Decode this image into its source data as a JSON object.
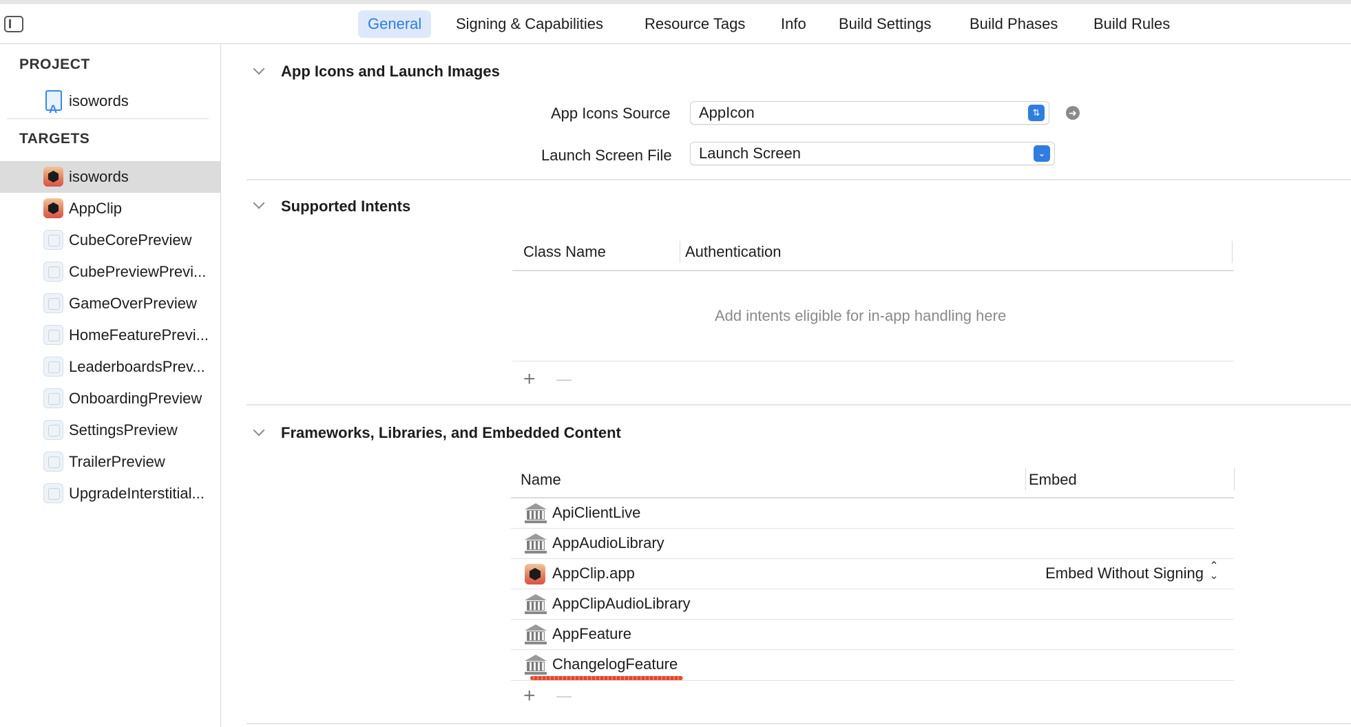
{
  "tabs": [
    {
      "label": "General",
      "active": true
    },
    {
      "label": "Signing & Capabilities"
    },
    {
      "label": "Resource Tags"
    },
    {
      "label": "Info"
    },
    {
      "label": "Build Settings"
    },
    {
      "label": "Build Phases"
    },
    {
      "label": "Build Rules"
    }
  ],
  "sidebar": {
    "project_header": "PROJECT",
    "project_name": "isowords",
    "targets_header": "TARGETS",
    "targets": [
      {
        "label": "isowords",
        "icon": "app-target-icon",
        "selected": true
      },
      {
        "label": "AppClip",
        "icon": "app-target-icon"
      },
      {
        "label": "CubeCorePreview",
        "icon": "preview-target-icon"
      },
      {
        "label": "CubePreviewPrevi...",
        "icon": "preview-target-icon"
      },
      {
        "label": "GameOverPreview",
        "icon": "preview-target-icon"
      },
      {
        "label": "HomeFeaturePrevi...",
        "icon": "preview-target-icon"
      },
      {
        "label": "LeaderboardsPrev...",
        "icon": "preview-target-icon"
      },
      {
        "label": "OnboardingPreview",
        "icon": "preview-target-icon"
      },
      {
        "label": "SettingsPreview",
        "icon": "preview-target-icon"
      },
      {
        "label": "TrailerPreview",
        "icon": "preview-target-icon"
      },
      {
        "label": "UpgradeInterstitial...",
        "icon": "preview-target-icon"
      }
    ]
  },
  "app_icons": {
    "title": "App Icons and Launch Images",
    "icons_source_label": "App Icons Source",
    "icons_source_value": "AppIcon",
    "launch_screen_label": "Launch Screen File",
    "launch_screen_value": "Launch Screen"
  },
  "intents": {
    "title": "Supported Intents",
    "col_class": "Class Name",
    "col_auth": "Authentication",
    "empty_message": "Add intents eligible for in-app handling here",
    "add": "+",
    "remove": "—"
  },
  "frameworks": {
    "title": "Frameworks, Libraries, and Embedded Content",
    "col_name": "Name",
    "col_embed": "Embed",
    "items": [
      {
        "name": "ApiClientLive",
        "icon": "library-icon",
        "embed": ""
      },
      {
        "name": "AppAudioLibrary",
        "icon": "library-icon",
        "embed": ""
      },
      {
        "name": "AppClip.app",
        "icon": "app-icon",
        "embed": "Embed Without Signing"
      },
      {
        "name": "AppClipAudioLibrary",
        "icon": "library-icon",
        "embed": ""
      },
      {
        "name": "AppFeature",
        "icon": "library-icon",
        "embed": ""
      },
      {
        "name": "ChangelogFeature",
        "icon": "library-icon",
        "embed": ""
      }
    ],
    "add": "+",
    "remove": "—"
  },
  "colors": {
    "accent": "#2f7de1",
    "selected_tab_bg": "#dde9fb",
    "selected_row_bg": "#dcdcdc",
    "spellcheck_underline": "#e6452c"
  }
}
